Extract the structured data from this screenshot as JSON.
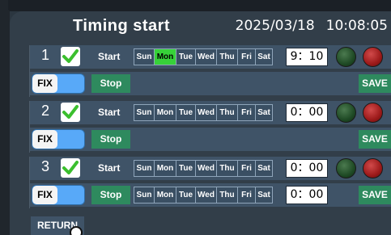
{
  "header": {
    "title": "Timing start",
    "date": "2025/03/18",
    "time": "10:08:05"
  },
  "labels": {
    "start": "Start",
    "stop": "Stop",
    "fix": "FIX",
    "save": "SAVE",
    "return": "RETURN"
  },
  "days": [
    "Sun",
    "Mon",
    "Tue",
    "Wed",
    "Thu",
    "Fri",
    "Sat"
  ],
  "groups": [
    {
      "number": "1",
      "enabled": true,
      "start_active_days": [
        "Mon"
      ],
      "start_time": "9：10",
      "stop_days_shown": false,
      "stop_time": ""
    },
    {
      "number": "2",
      "enabled": true,
      "start_active_days": [],
      "start_time": "0：00",
      "stop_days_shown": false,
      "stop_time": ""
    },
    {
      "number": "3",
      "enabled": true,
      "start_active_days": [],
      "start_time": "0：00",
      "stop_days_shown": true,
      "stop_time": "0：00"
    }
  ],
  "colors": {
    "active_day": "#37d239",
    "button_green": "#2e8a5e",
    "fix_blue": "#58a9f8",
    "row_bg": "#3f5367"
  },
  "icons": {
    "checkbox": "check-icon",
    "status_on": "green-led-icon",
    "status_off": "red-led-icon"
  }
}
